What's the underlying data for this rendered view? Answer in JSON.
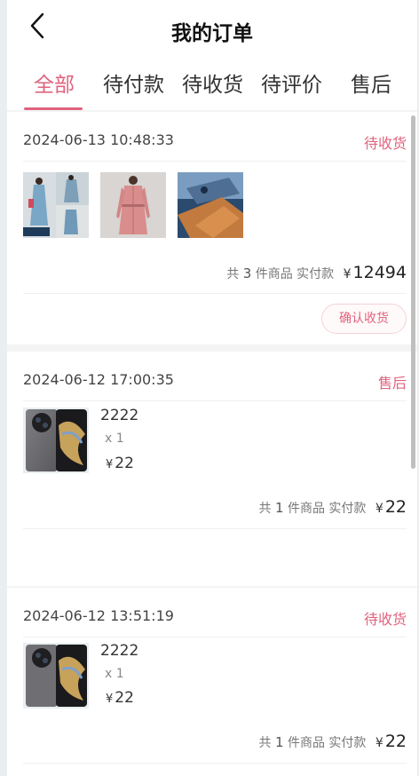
{
  "header": {
    "title": "我的订单",
    "tabs": [
      "全部",
      "待付款",
      "待收货",
      "待评价",
      "售后"
    ],
    "active_tab": 0
  },
  "colors": {
    "accent": "#e0637e"
  },
  "orders": [
    {
      "date": "2024-06-13 10:48:33",
      "status": "待收货",
      "summary_prefix": "共",
      "count": "3",
      "summary_suffix": "件商品 实付款",
      "currency": "¥",
      "total": "12494",
      "action": "确认收货"
    },
    {
      "date": "2024-06-12 17:00:35",
      "status": "售后",
      "item_name": "2222",
      "item_qty": "x 1",
      "item_currency": "¥",
      "item_price": "22",
      "summary_prefix": "共",
      "count": "1",
      "summary_suffix": "件商品 实付款",
      "currency": "¥",
      "total": "22"
    },
    {
      "date": "2024-06-12 13:51:19",
      "status": "待收货",
      "item_name": "2222",
      "item_qty": "x 1",
      "item_currency": "¥",
      "item_price": "22",
      "summary_prefix": "共",
      "count": "1",
      "summary_suffix": "件商品 实付款",
      "currency": "¥",
      "total": "22"
    }
  ]
}
